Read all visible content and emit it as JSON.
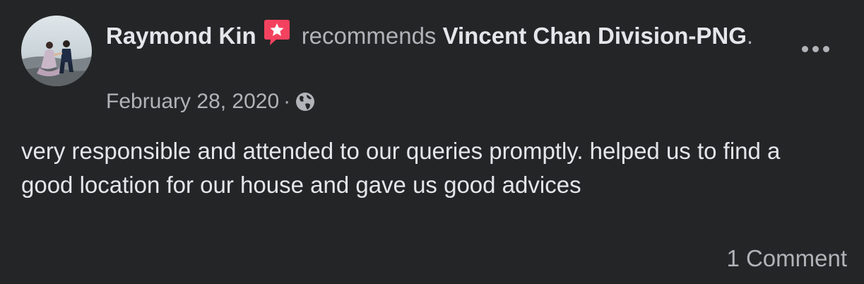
{
  "post": {
    "author": "Raymond Kin",
    "verb": "recommends",
    "page_name": "Vincent Chan Division-PNG",
    "period": ".",
    "date": "February 28, 2020",
    "dot": "·",
    "privacy_icon": "globe-icon",
    "recommend_icon": "recommend-star-icon",
    "more_icon": "more-horizontal-icon",
    "text": "very responsible and attended to our queries promptly. helped us to find a good location for our house and gave us good advices",
    "comments": "1 Comment"
  },
  "colors": {
    "background": "#242526",
    "primary_text": "#e4e6eb",
    "secondary_text": "#b0b3b8",
    "recommend_badge": "#f3425f"
  }
}
